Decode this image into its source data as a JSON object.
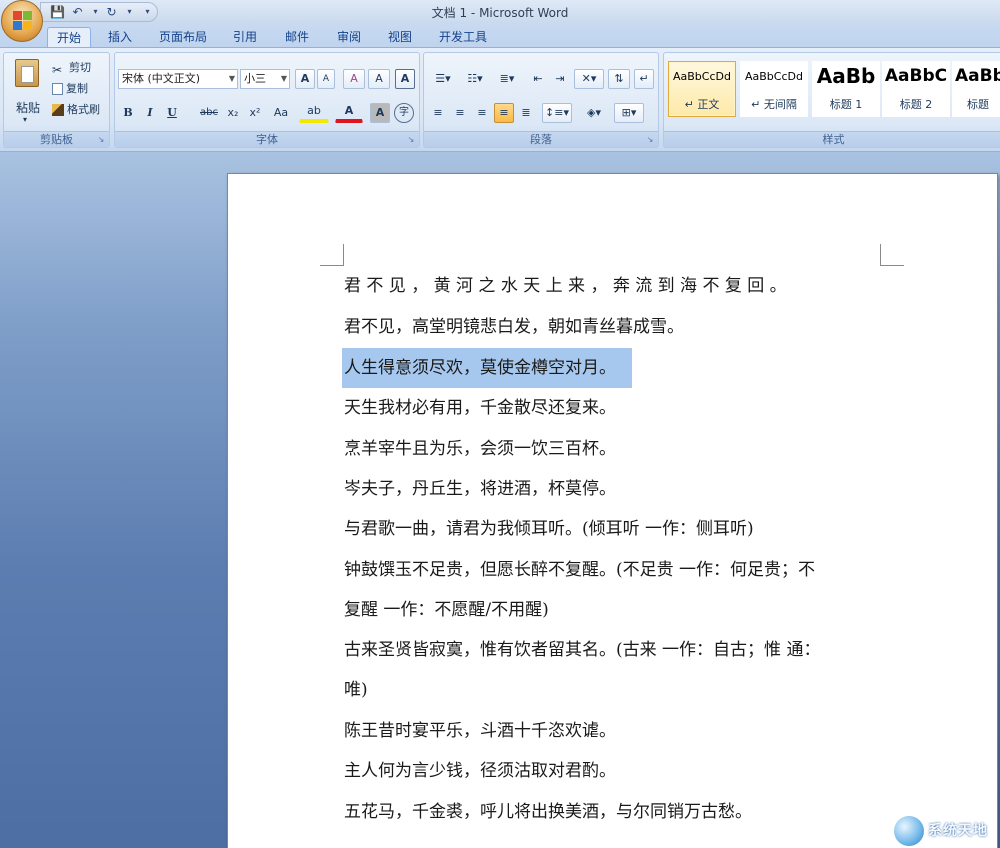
{
  "window": {
    "title": "文档 1 - Microsoft Word"
  },
  "quick_access": {
    "save": "💾",
    "undo": "↶",
    "redo": "↻",
    "customize": "▾"
  },
  "tabs": [
    {
      "label": "开始",
      "active": true
    },
    {
      "label": "插入"
    },
    {
      "label": "页面布局"
    },
    {
      "label": "引用"
    },
    {
      "label": "邮件"
    },
    {
      "label": "审阅"
    },
    {
      "label": "视图"
    },
    {
      "label": "开发工具"
    }
  ],
  "clipboard": {
    "paste": "粘贴",
    "cut": "剪切",
    "copy": "复制",
    "format_painter": "格式刷",
    "group": "剪贴板"
  },
  "font": {
    "name": "宋体 (中文正文)",
    "size": "小三",
    "group": "字体",
    "grow": "A",
    "shrink": "A",
    "clear": "A",
    "phonetic": "A",
    "bold": "B",
    "italic": "I",
    "underline": "U",
    "strike": "abc",
    "sub": "x₂",
    "sup": "x²",
    "case": "Aa",
    "highlight": "ab",
    "color": "A",
    "shading": "A",
    "enclose": "字"
  },
  "paragraph": {
    "group": "段落"
  },
  "styles": {
    "group": "样式",
    "items": [
      {
        "sample": "AaBbCcDd",
        "name": "↵ 正文",
        "selected": true
      },
      {
        "sample": "AaBbCcDd",
        "name": "↵ 无间隔"
      },
      {
        "sample": "AaBb",
        "name": "标题 1"
      },
      {
        "sample": "AaBbC",
        "name": "标题 2"
      },
      {
        "sample": "AaBb",
        "name": "标题"
      }
    ]
  },
  "document": {
    "lines": [
      "君 不 见 ， 黄 河 之 水 天 上 来 ， 奔 流 到 海 不 复 回 。",
      "君不见，高堂明镜悲白发，朝如青丝暮成雪。",
      "人生得意须尽欢，莫使金樽空对月。",
      "天生我材必有用，千金散尽还复来。",
      "烹羊宰牛且为乐，会须一饮三百杯。",
      "岑夫子，丹丘生，将进酒，杯莫停。",
      "与君歌一曲，请君为我倾耳听。(倾耳听  一作：侧耳听)",
      "钟鼓馔玉不足贵，但愿长醉不复醒。(不足贵  一作：何足贵；不",
      "复醒  一作：不愿醒/不用醒)",
      "古来圣贤皆寂寞，惟有饮者留其名。(古来  一作：自古；惟  通：",
      "唯)",
      "陈王昔时宴平乐，斗酒十千恣欢谑。",
      "主人何为言少钱，径须沽取对君酌。",
      "五花马，千金裘，呼儿将出换美酒，与尔同销万古愁。"
    ],
    "selected_line": 2
  },
  "watermark": {
    "text": "系统天地"
  },
  "colors": {
    "highlight": "#a6c8ee",
    "ribbon": "#dce8f6",
    "accent": "#15428b"
  }
}
